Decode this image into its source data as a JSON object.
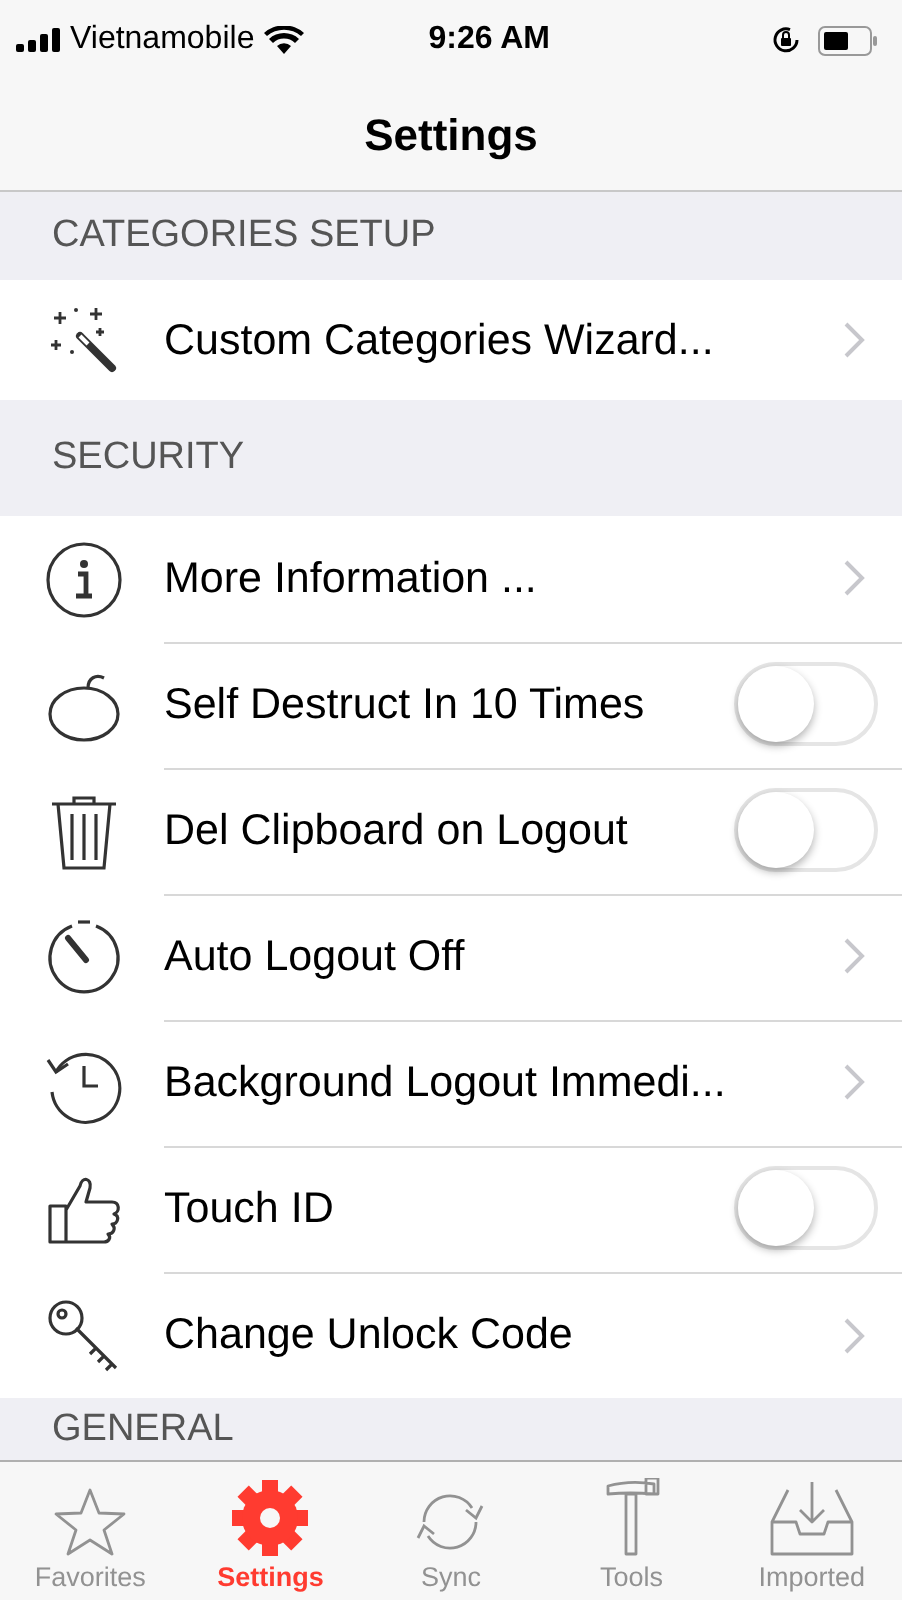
{
  "status_bar": {
    "carrier": "Vietnamobile",
    "time": "9:26 AM"
  },
  "nav_bar": {
    "title": "Settings"
  },
  "sections": [
    {
      "header": "CATEGORIES SETUP",
      "rows": [
        {
          "label": "Custom Categories Wizard...",
          "kind": "link"
        }
      ]
    },
    {
      "header": "SECURITY",
      "rows": [
        {
          "label": "More Information ...",
          "kind": "link"
        },
        {
          "label": "Self Destruct In 10 Times",
          "kind": "toggle",
          "on": false
        },
        {
          "label": "Del Clipboard on Logout",
          "kind": "toggle",
          "on": false
        },
        {
          "label": "Auto Logout Off",
          "kind": "link"
        },
        {
          "label": "Background Logout Immedi...",
          "kind": "link"
        },
        {
          "label": "Touch ID",
          "kind": "toggle",
          "on": false
        },
        {
          "label": "Change Unlock Code",
          "kind": "link"
        }
      ]
    },
    {
      "header": "GENERAL"
    }
  ],
  "tab_bar": [
    {
      "label": "Favorites",
      "selected": false
    },
    {
      "label": "Settings",
      "selected": true
    },
    {
      "label": "Sync",
      "selected": false
    },
    {
      "label": "Tools",
      "selected": false
    },
    {
      "label": "Imported",
      "selected": false
    }
  ]
}
